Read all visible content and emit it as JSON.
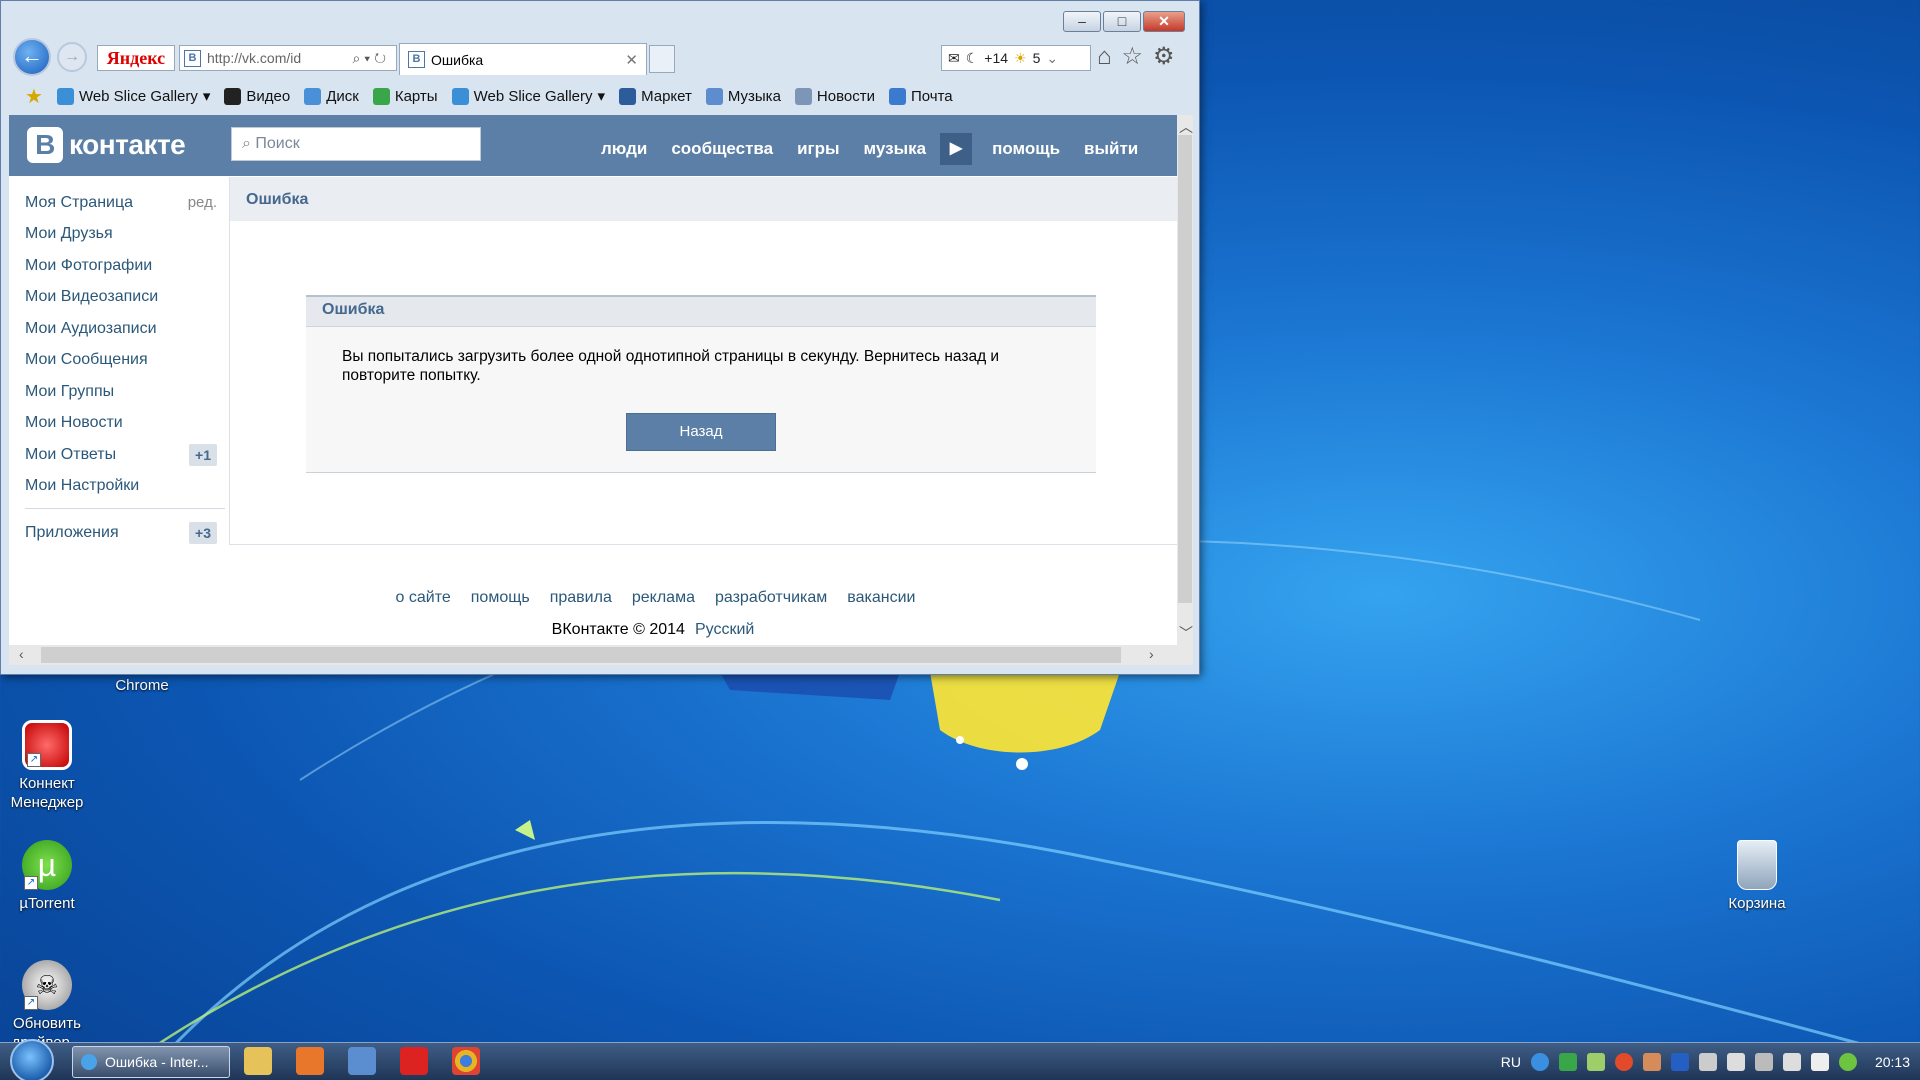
{
  "browser": {
    "yandex_label": "Яндекс",
    "url": "http://vk.com/id",
    "tab_title": "Ошибка",
    "mail_count": "+14",
    "weather_count": "5",
    "favorites": [
      {
        "label": "Web Slice Gallery",
        "dropdown": true
      },
      {
        "label": "Видео"
      },
      {
        "label": "Диск"
      },
      {
        "label": "Карты"
      },
      {
        "label": "Web Slice Gallery",
        "dropdown": true
      },
      {
        "label": "Маркет"
      },
      {
        "label": "Музыка"
      },
      {
        "label": "Новости"
      },
      {
        "label": "Почта"
      }
    ],
    "window_buttons": {
      "minimize": "–",
      "maximize": "□",
      "close": "✕"
    }
  },
  "vk": {
    "logo_text": "контакте",
    "logo_letter": "В",
    "search_placeholder": "Поиск",
    "nav": [
      "люди",
      "сообщества",
      "игры",
      "музыка",
      "помощь",
      "выйти"
    ],
    "sidebar": [
      {
        "label": "Моя Страница",
        "extra": "ред."
      },
      {
        "label": "Мои Друзья"
      },
      {
        "label": "Мои Фотографии"
      },
      {
        "label": "Мои Видеозаписи"
      },
      {
        "label": "Мои Аудиозаписи"
      },
      {
        "label": "Мои Сообщения"
      },
      {
        "label": "Мои Группы"
      },
      {
        "label": "Мои Новости"
      },
      {
        "label": "Мои Ответы",
        "badge": "+1"
      },
      {
        "label": "Мои Настройки"
      }
    ],
    "apps": {
      "label": "Приложения",
      "badge": "+3"
    },
    "page_title": "Ошибка",
    "error": {
      "title": "Ошибка",
      "message": "Вы попытались загрузить более одной однотипной страницы в секунду. Вернитесь назад и повторите попытку.",
      "button": "Назад"
    },
    "footer_links": [
      "о сайте",
      "помощь",
      "правила",
      "реклама",
      "разработчикам",
      "вакансии"
    ],
    "copyright": "ВКонтакте © 2014",
    "language": "Русский"
  },
  "desktop": {
    "chrome_label": "Chrome",
    "icons": [
      {
        "label": "Коннект Менеджер"
      },
      {
        "label": "µTorrent"
      },
      {
        "label": "Обновить драйвер..."
      },
      {
        "label": "Корзина"
      }
    ]
  },
  "taskbar": {
    "active_task": "Ошибка - Inter...",
    "language": "RU",
    "time": "20:13"
  },
  "colors": {
    "vk_header": "#5b7fa6",
    "vk_link": "#2b587a",
    "desktop_blue": "#1b76d2"
  }
}
